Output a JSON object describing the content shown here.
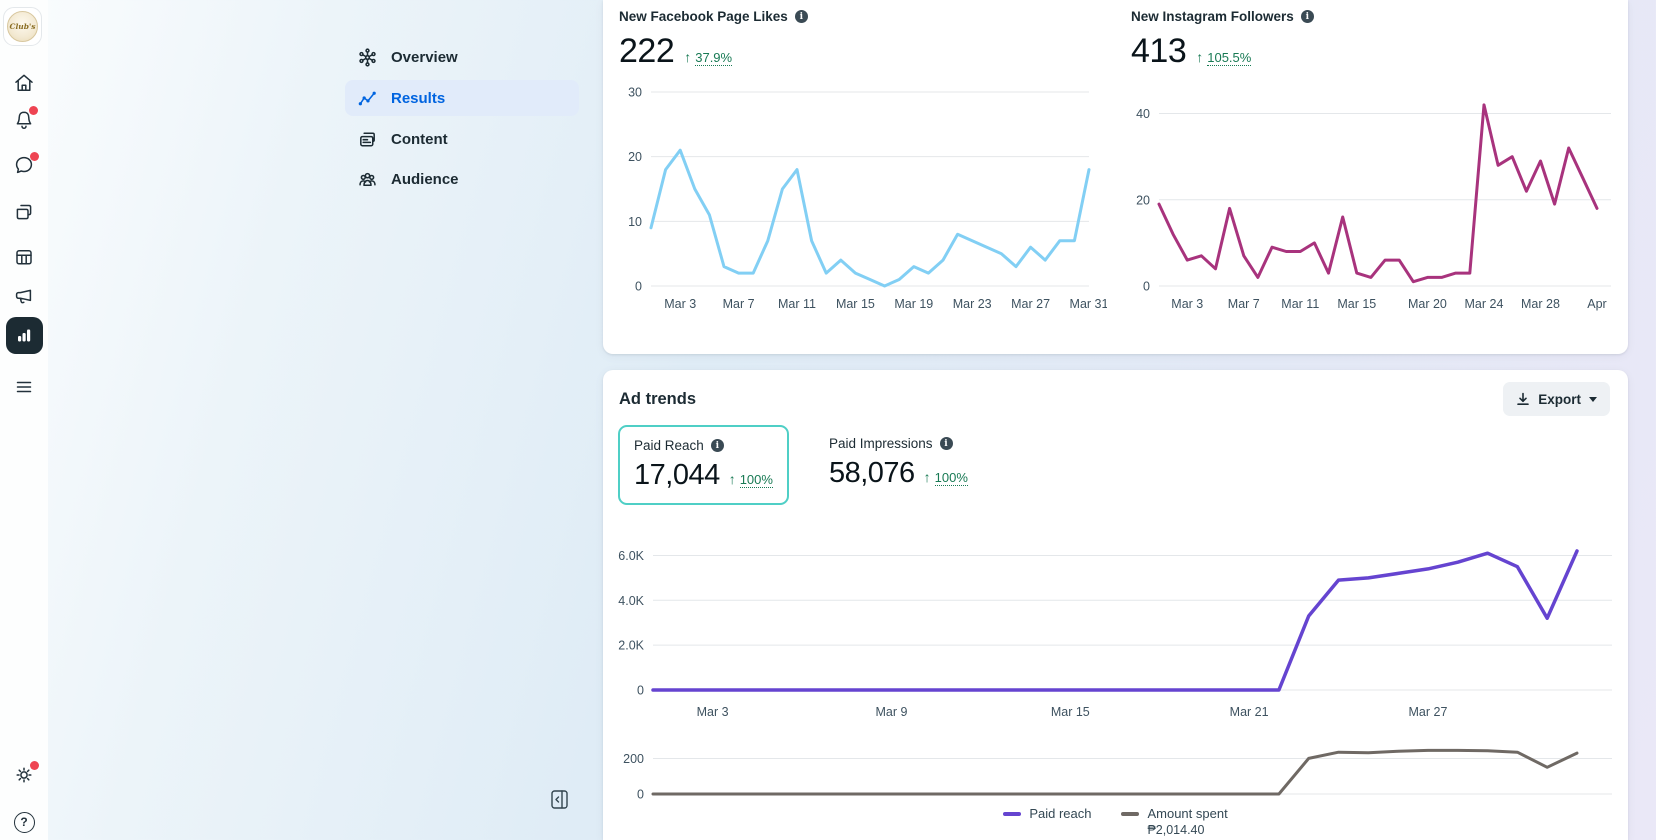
{
  "icons": {
    "up_arrow": "↑",
    "info_glyph": "i",
    "help_glyph": "?"
  },
  "brand": {
    "logo_text": "Club's"
  },
  "sidebar": {
    "items": [
      {
        "label": "Overview",
        "selected": false
      },
      {
        "label": "Results",
        "selected": true
      },
      {
        "label": "Content",
        "selected": false
      },
      {
        "label": "Audience",
        "selected": false
      }
    ]
  },
  "growth_card": {
    "facebook": {
      "value": "222",
      "delta": "37.9%"
    },
    "instagram": {
      "value": "413",
      "delta": "105.5%"
    }
  },
  "ad_trends": {
    "title": "Ad trends",
    "export_label": "Export",
    "tiles": [
      {
        "label": "Paid Reach",
        "value": "17,044",
        "delta": "100%",
        "selected": true
      },
      {
        "label": "Paid Impressions",
        "value": "58,076",
        "delta": "100%",
        "selected": false
      }
    ],
    "legend": [
      {
        "label": "Paid reach",
        "color": "#6544d0"
      },
      {
        "label": "Amount spent",
        "color": "#6f6964",
        "sublabel": "₱2,014.40"
      }
    ]
  },
  "colors": {
    "facebook_line": "#82cff4",
    "instagram_line": "#a8337d",
    "paid_reach_line": "#6544d0",
    "amount_spent_line": "#6f6964",
    "selected_nav": "#0064e0",
    "positive_green": "#187a54",
    "selected_tile_border": "#4fcfc6"
  },
  "chart_data": [
    {
      "id": "facebook_page_likes",
      "type": "line",
      "title": "New Facebook Page Likes",
      "color": "#82cff4",
      "ylim": [
        0,
        30
      ],
      "yticks": [
        0,
        10,
        20,
        30
      ],
      "ytick_labels": [
        "0",
        "10",
        "20",
        "30"
      ],
      "xtick_labels": [
        "Mar 3",
        "Mar 7",
        "Mar 11",
        "Mar 15",
        "Mar 19",
        "Mar 23",
        "Mar 27",
        "Mar 31"
      ],
      "xtick_index": [
        2,
        6,
        10,
        14,
        18,
        22,
        26,
        30
      ],
      "values": [
        9,
        18,
        21,
        15,
        11,
        3,
        2,
        2,
        7,
        15,
        18,
        7,
        2,
        4,
        2,
        1,
        0,
        1,
        3,
        2,
        4,
        8,
        7,
        6,
        5,
        3,
        6,
        4,
        7,
        7,
        18
      ]
    },
    {
      "id": "instagram_followers",
      "type": "line",
      "title": "New Instagram Followers",
      "color": "#a8337d",
      "ylim": [
        0,
        45
      ],
      "yticks": [
        0,
        20,
        40
      ],
      "ytick_labels": [
        "0",
        "20",
        "40"
      ],
      "xtick_labels": [
        "Mar 3",
        "Mar 7",
        "Mar 11",
        "Mar 15",
        "Mar 20",
        "Mar 24",
        "Mar 28",
        "Apr"
      ],
      "xtick_index": [
        2,
        6,
        10,
        14,
        19,
        23,
        27,
        31
      ],
      "values": [
        19,
        12,
        6,
        7,
        4,
        18,
        7,
        2,
        9,
        8,
        8,
        10,
        3,
        16,
        3,
        2,
        6,
        6,
        1,
        2,
        2,
        3,
        3,
        42,
        28,
        30,
        22,
        29,
        19,
        32,
        25,
        18
      ]
    },
    {
      "id": "paid_reach",
      "type": "line",
      "title": "Paid reach",
      "color": "#6544d0",
      "ylim": [
        0,
        6600
      ],
      "yticks": [
        0,
        2000,
        4000,
        6000
      ],
      "ytick_labels": [
        "0",
        "2.0K",
        "4.0K",
        "6.0K"
      ],
      "xtick_labels": [
        "Mar 3",
        "Mar 9",
        "Mar 15",
        "Mar 21",
        "Mar 27"
      ],
      "xtick_index": [
        2,
        8,
        14,
        20,
        26
      ],
      "values": [
        0,
        0,
        0,
        0,
        0,
        0,
        0,
        0,
        0,
        0,
        0,
        0,
        0,
        0,
        0,
        0,
        0,
        0,
        0,
        0,
        0,
        0,
        3300,
        4900,
        5000,
        5200,
        5400,
        5700,
        6100,
        5500,
        3200,
        6200
      ]
    },
    {
      "id": "amount_spent",
      "type": "line",
      "title": "Amount spent",
      "color": "#6f6964",
      "ylim": [
        0,
        270
      ],
      "yticks": [
        0,
        200
      ],
      "ytick_labels": [
        "0",
        "200"
      ],
      "xtick_labels": [],
      "xtick_index": [],
      "values": [
        0,
        0,
        0,
        0,
        0,
        0,
        0,
        0,
        0,
        0,
        0,
        0,
        0,
        0,
        0,
        0,
        0,
        0,
        0,
        0,
        0,
        0,
        200,
        235,
        232,
        240,
        245,
        245,
        243,
        235,
        150,
        230
      ]
    }
  ]
}
